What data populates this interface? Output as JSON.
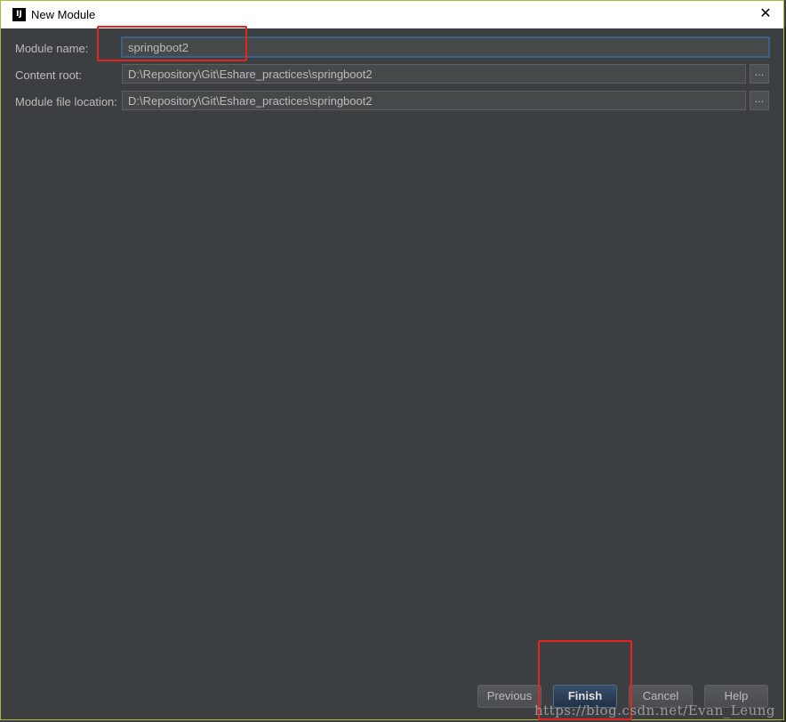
{
  "window": {
    "title": "New Module",
    "app_icon": "IJ",
    "close_glyph": "✕"
  },
  "form": {
    "module_name": {
      "label": "Module name:",
      "value": "springboot2"
    },
    "content_root": {
      "label": "Content root:",
      "value": "D:\\Repository\\Git\\Eshare_practices\\springboot2",
      "browse": "..."
    },
    "module_file_location": {
      "label": "Module file location:",
      "value": "D:\\Repository\\Git\\Eshare_practices\\springboot2",
      "browse": "..."
    }
  },
  "buttons": {
    "previous": "Previous",
    "finish": "Finish",
    "cancel": "Cancel",
    "help": "Help"
  },
  "watermark": "https://blog.csdn.net/Evan_Leung",
  "colors": {
    "dialog_bg": "#3c3f41",
    "accent_border": "#a9b93c",
    "highlight_red": "#e8231c",
    "default_button": "#2f4257"
  }
}
